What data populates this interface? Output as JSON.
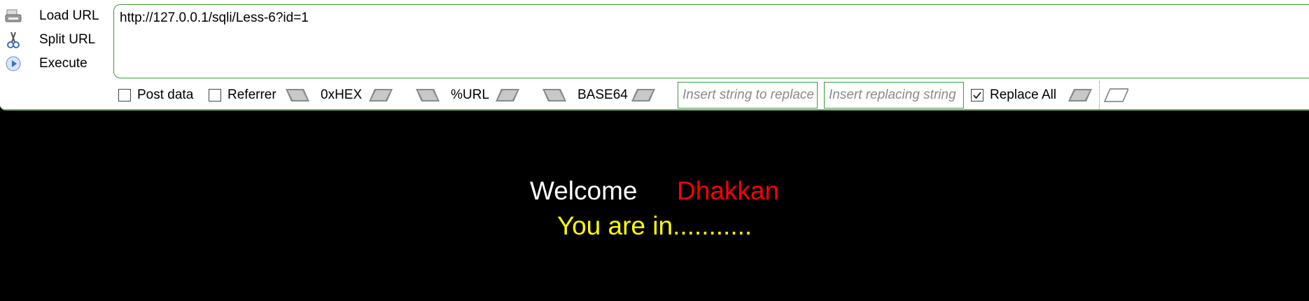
{
  "hackbar": {
    "actions": [
      {
        "label": "Load URL",
        "icon": "load-url-icon"
      },
      {
        "label": "Split URL",
        "icon": "split-url-icon"
      },
      {
        "label": "Execute",
        "icon": "execute-icon"
      }
    ],
    "url_value": "http://127.0.0.1/sqli/Less-6?id=1",
    "toolbar": {
      "post_data": {
        "label": "Post data",
        "checked": false
      },
      "referrer": {
        "label": "Referrer",
        "checked": false
      },
      "hex_label": "0xHEX",
      "url_label": "%URL",
      "base64_label": "BASE64",
      "replace_string_placeholder": "Insert string to replace",
      "replacing_string_placeholder": "Insert replacing string",
      "replace_all": {
        "label": "Replace All",
        "checked": true
      }
    }
  },
  "page": {
    "welcome": "Welcome",
    "name": "Dhakkan",
    "status": "You are in..........."
  },
  "colors": {
    "welcome": "#ffffff",
    "name": "#ff0000",
    "status": "#ffff00",
    "background": "#000000",
    "border_green": "#3a9b3a"
  }
}
